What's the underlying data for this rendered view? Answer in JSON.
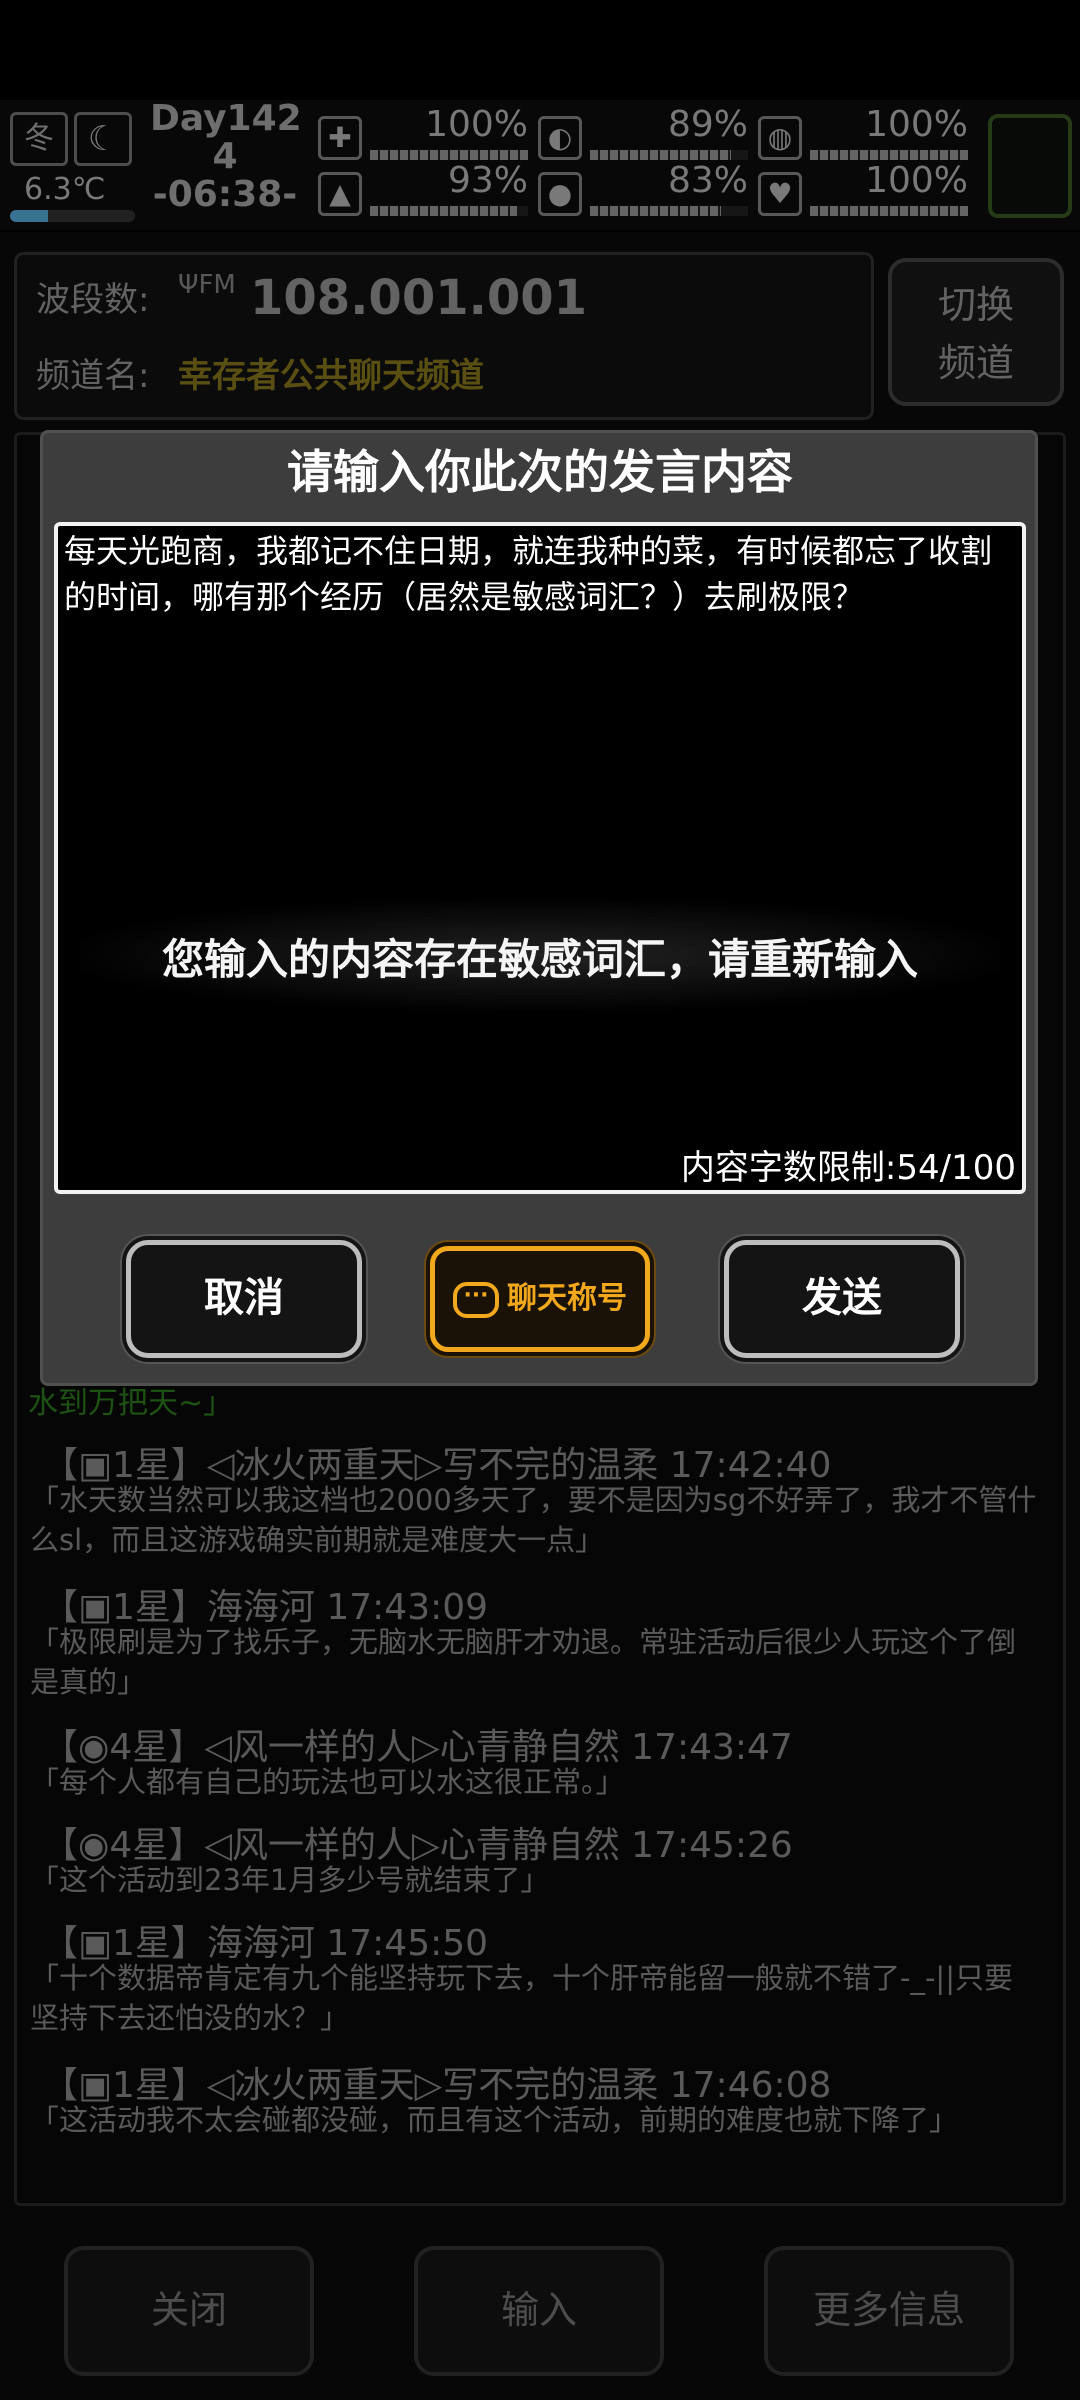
{
  "status": {
    "season": "冬",
    "moon_icon": "moon-icon",
    "temperature": "6.3℃",
    "temperature_level": 0.3,
    "day_line1": "Day142",
    "day_line2": "4",
    "time": "-06:38-",
    "stats": [
      {
        "icon": "medkit-icon",
        "glyph": "✚",
        "value": "100%",
        "level": 1.0
      },
      {
        "icon": "stomach-icon",
        "glyph": "◐",
        "value": "89%",
        "level": 0.89
      },
      {
        "icon": "pill-icon",
        "glyph": "◍",
        "value": "100%",
        "level": 1.0
      },
      {
        "icon": "boot-icon",
        "glyph": "▲",
        "value": "93%",
        "level": 0.93
      },
      {
        "icon": "water-drop-icon",
        "glyph": "●",
        "value": "83%",
        "level": 0.83
      },
      {
        "icon": "heart-icon",
        "glyph": "♥",
        "value": "100%",
        "level": 1.0
      }
    ]
  },
  "radio": {
    "freq_label": "波段数:",
    "fm_icon": "FM",
    "frequency": "108.001.001",
    "channel_label": "频道名:",
    "channel_name": "幸存者公共聊天频道",
    "switch_line1": "切换",
    "switch_line2": "频道"
  },
  "chat": {
    "tail_text": "水到万把天~」",
    "messages": [
      {
        "head": "【▣1星】◁冰火两重天▷写不完的温柔 17:42:40",
        "body": "「水天数当然可以我这档也2000多天了，要不是因为sg不好弄了，我才不管什么sl，而且这游戏确实前期就是难度大一点」"
      },
      {
        "head": "【▣1星】海海河 17:43:09",
        "body": "「极限刷是为了找乐子，无脑水无脑肝才劝退。常驻活动后很少人玩这个了倒是真的」"
      },
      {
        "head": "【◉4星】◁风一样的人▷心青静自然 17:43:47",
        "body": "「每个人都有自己的玩法也可以水这很正常。」"
      },
      {
        "head": "【◉4星】◁风一样的人▷心青静自然 17:45:26",
        "body": "「这个活动到23年1月多少号就结束了」"
      },
      {
        "head": "【▣1星】海海河 17:45:50",
        "body": "「十个数据帝肯定有九个能坚持玩下去，十个肝帝能留一般就不错了-_-||只要坚持下去还怕没的水？」"
      },
      {
        "head": "【▣1星】◁冰火两重天▷写不完的温柔 17:46:08",
        "body": "「这活动我不太会碰都没碰，而且有这个活动，前期的难度也就下降了」"
      }
    ]
  },
  "bottom": {
    "close": "关闭",
    "input": "输入",
    "more": "更多信息"
  },
  "dialog": {
    "title": "请输入你此次的发言内容",
    "text": "每天光跑商，我都记不住日期，就连我种的菜，有时候都忘了收割的时间，哪有那个经历（居然是敏感词汇？）去刷极限？",
    "toast": "您输入的内容存在敏感词汇，请重新输入",
    "char_count": "内容字数限制:54/100",
    "cancel": "取消",
    "nickname": "聊天称号",
    "send": "发送"
  }
}
